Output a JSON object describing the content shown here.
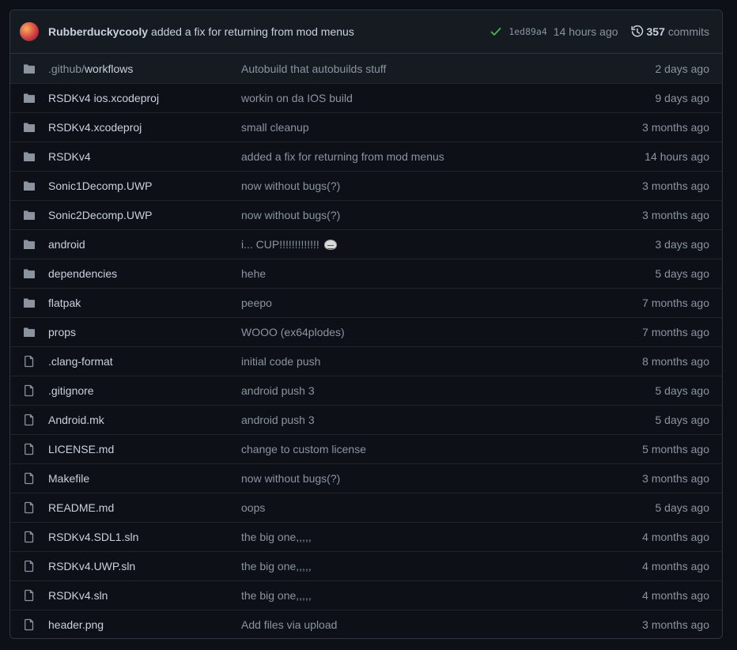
{
  "latest_commit": {
    "author": "Rubberduckycooly",
    "message": "added a fix for returning from mod menus",
    "status": "success",
    "sha": "1ed89a4",
    "time": "14 hours ago",
    "commit_count": "357",
    "commits_label": "commits"
  },
  "colors": {
    "background": "#0d1117",
    "header_bg": "#161b22",
    "border": "#30363d",
    "text": "#c9d1d9",
    "muted": "#8b949e",
    "success": "#3fb950",
    "icon": "#8b949e"
  },
  "files": [
    {
      "type": "folder",
      "name_prefix": ".github/",
      "name": "workflows",
      "message": "Autobuild that autobuilds stuff",
      "age": "2 days ago"
    },
    {
      "type": "folder",
      "name_prefix": "",
      "name": "RSDKv4 ios.xcodeproj",
      "message": "workin on da IOS build",
      "age": "9 days ago"
    },
    {
      "type": "folder",
      "name_prefix": "",
      "name": "RSDKv4.xcodeproj",
      "message": "small cleanup",
      "age": "3 months ago"
    },
    {
      "type": "folder",
      "name_prefix": "",
      "name": "RSDKv4",
      "message": "added a fix for returning from mod menus",
      "age": "14 hours ago"
    },
    {
      "type": "folder",
      "name_prefix": "",
      "name": "Sonic1Decomp.UWP",
      "message": "now without bugs(?)",
      "age": "3 months ago"
    },
    {
      "type": "folder",
      "name_prefix": "",
      "name": "Sonic2Decomp.UWP",
      "message": "now without bugs(?)",
      "age": "3 months ago"
    },
    {
      "type": "folder",
      "name_prefix": "",
      "name": "android",
      "message": "i... CUP!!!!!!!!!!!!!",
      "emoji": "trollface",
      "age": "3 days ago"
    },
    {
      "type": "folder",
      "name_prefix": "",
      "name": "dependencies",
      "message": "hehe",
      "age": "5 days ago"
    },
    {
      "type": "folder",
      "name_prefix": "",
      "name": "flatpak",
      "message": "peepo",
      "age": "7 months ago"
    },
    {
      "type": "folder",
      "name_prefix": "",
      "name": "props",
      "message": "WOOO (ex64plodes)",
      "age": "7 months ago"
    },
    {
      "type": "file",
      "name_prefix": "",
      "name": ".clang-format",
      "message": "initial code push",
      "age": "8 months ago"
    },
    {
      "type": "file",
      "name_prefix": "",
      "name": ".gitignore",
      "message": "android push 3",
      "age": "5 days ago"
    },
    {
      "type": "file",
      "name_prefix": "",
      "name": "Android.mk",
      "message": "android push 3",
      "age": "5 days ago"
    },
    {
      "type": "file",
      "name_prefix": "",
      "name": "LICENSE.md",
      "message": "change to custom license",
      "age": "5 months ago"
    },
    {
      "type": "file",
      "name_prefix": "",
      "name": "Makefile",
      "message": "now without bugs(?)",
      "age": "3 months ago"
    },
    {
      "type": "file",
      "name_prefix": "",
      "name": "README.md",
      "message": "oops",
      "age": "5 days ago"
    },
    {
      "type": "file",
      "name_prefix": "",
      "name": "RSDKv4.SDL1.sln",
      "message": "the big one,,,,,",
      "age": "4 months ago"
    },
    {
      "type": "file",
      "name_prefix": "",
      "name": "RSDKv4.UWP.sln",
      "message": "the big one,,,,,",
      "age": "4 months ago"
    },
    {
      "type": "file",
      "name_prefix": "",
      "name": "RSDKv4.sln",
      "message": "the big one,,,,,",
      "age": "4 months ago"
    },
    {
      "type": "file",
      "name_prefix": "",
      "name": "header.png",
      "message": "Add files via upload",
      "age": "3 months ago"
    }
  ]
}
